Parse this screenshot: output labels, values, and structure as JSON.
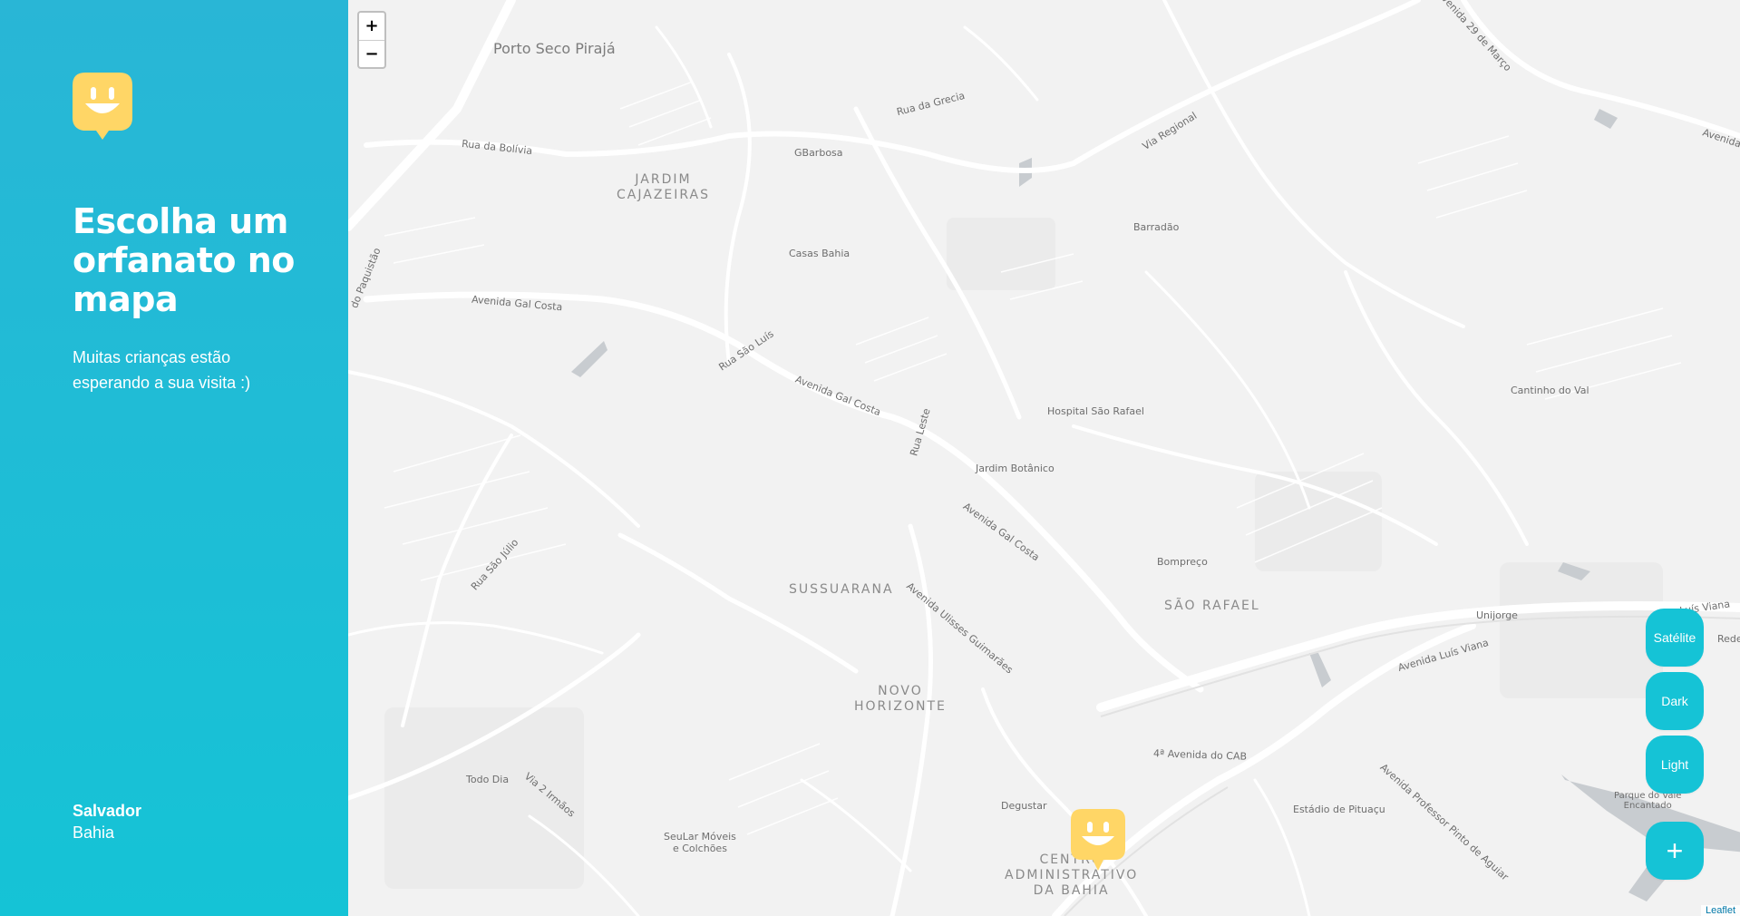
{
  "sidebar": {
    "headline": "Escolha um orfanato no mapa",
    "subtitle": "Muitas crianças estão esperando a sua visita :)",
    "city": "Salvador",
    "state": "Bahia",
    "logo_icon": "happy-face-marker-icon",
    "accent_color": "#15c3d6",
    "marker_color": "#ffd666"
  },
  "map": {
    "zoom_in": "+",
    "zoom_out": "−",
    "attribution": "Leaflet",
    "labels": {
      "porto_seco": "Porto Seco Pirajá",
      "rua_bolivia": "Rua da Bolívia",
      "gbarbosa": "GBarbosa",
      "jardim_cajazeiras": "JARDIM\nCAJAZEIRAS",
      "rua_grecia": "Rua da Grecia",
      "via_regional": "Via Regional",
      "av_29_marco": "venida 29 de Março",
      "avenida_right": "Avenida",
      "barradao": "Barradão",
      "casas_bahia": "Casas Bahia",
      "av_gal_costa_1": "Avenida Gal Costa",
      "rua_sao_luis": "Rua São Luís",
      "av_gal_costa_2": "Avenida Gal Costa",
      "rua_leste": "Rua Leste",
      "hospital": "Hospital São Rafael",
      "cantinho": "Cantinho do Val",
      "jardim_botanico": "Jardim Botânico",
      "av_gal_costa_3": "Avenida Gal Costa",
      "bompreco": "Bompreço",
      "sussuarana": "SUSSUARANA",
      "sao_rafael": "SÃO RAFAEL",
      "av_ulisses": "Avenida Ulisses Guimarães",
      "rua_sao_julio": "Rua São Júlio",
      "novo_horizonte": "NOVO\nHORIZONTE",
      "unijorge": "Unijorge",
      "av_luis_viana": "Avenida Luís Viana",
      "av_luis_viana_2": "a Luís Viana",
      "rede": "Rede",
      "av_cab": "4ª Avenida do CAB",
      "todo_dia": "Todo Dia",
      "via_2_irmaos": "Via 2 Irmãos",
      "degustar": "Degustar",
      "estadio": "Estádio de Pituaçu",
      "av_prof_pinto": "Avenida Professor Pinto de Aguiar",
      "parque_vale": "Parque do Vale\nEncantado",
      "seular": "SeuLar Móveis\ne Colchões",
      "centro_adm": "CENTRO\nADMINISTRATIVO\nDA BAHIA",
      "paquistao": "do Paquistão"
    }
  },
  "buttons": {
    "satellite": "Satélite",
    "dark": "Dark",
    "light": "Light",
    "add": "+"
  }
}
